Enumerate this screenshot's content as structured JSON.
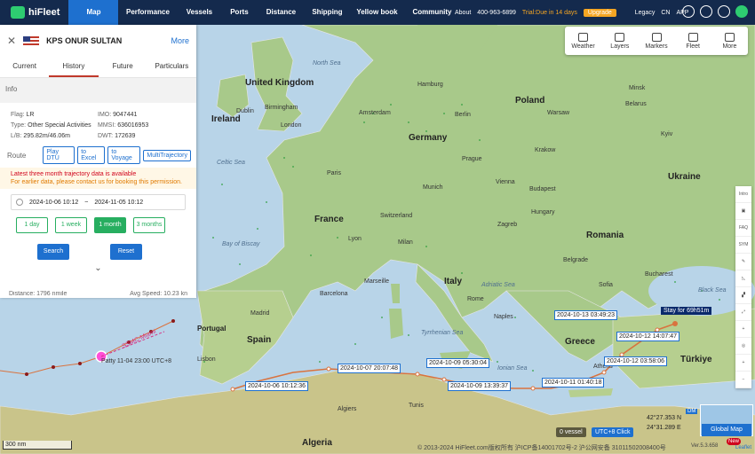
{
  "nav": {
    "brand": "hiFleet",
    "items": [
      "Map",
      "Performance",
      "Vessels",
      "Ports",
      "Distance",
      "Shipping",
      "Yellow book",
      "Community"
    ],
    "active": "Map",
    "about": "About",
    "phone": "400-963-6899",
    "trial": "Trial:Due in 14 days",
    "upgrade": "Upgrade",
    "legacy": "Legacy",
    "lang": "CN",
    "app": "APP"
  },
  "panel": {
    "ship_name": "KPS ONUR SULTAN",
    "more": "More",
    "tabs": [
      "Current",
      "History",
      "Future",
      "Particulars"
    ],
    "active_tab": "History",
    "info_title": "Info",
    "fields": [
      {
        "label": "Flag:",
        "value": "LR"
      },
      {
        "label": "IMO:",
        "value": "9047441"
      },
      {
        "label": "Type:",
        "value": "Other Special Activities"
      },
      {
        "label": "MMSI:",
        "value": "636016953"
      },
      {
        "label": "L/B:",
        "value": "295.82m/46.06m"
      },
      {
        "label": "DWT:",
        "value": "172639"
      }
    ],
    "route_label": "Route",
    "route_buttons": [
      "Play DTU",
      "to Excel",
      "to Voyage",
      "MultiTrajectory"
    ],
    "notice_line1": "Latest three month trajectory data is available",
    "notice_line2": "For earlier data, please contact us for booking this permission.",
    "date_from": "2024-10-06 10:12",
    "date_sep": "~",
    "date_to": "2024-11-05 10:12",
    "quick": [
      "1 day",
      "1 week",
      "1 month",
      "3 months"
    ],
    "quick_active": "1 month",
    "search": "Search",
    "reset": "Reset",
    "distance": "Distance: 1796 nmile",
    "avg_speed": "Avg Speed: 10.23 kn"
  },
  "tools": [
    "Weather",
    "Layers",
    "Markers",
    "Fleet",
    "More"
  ],
  "vbar": [
    "Intro",
    "",
    "FAQ",
    "SYM",
    "",
    "",
    "",
    "",
    "+",
    "",
    "+",
    "−"
  ],
  "map": {
    "countries": [
      {
        "name": "United Kingdom"
      },
      {
        "name": "Ireland"
      },
      {
        "name": "Poland"
      },
      {
        "name": "Germany"
      },
      {
        "name": "France"
      },
      {
        "name": "Ukraine"
      },
      {
        "name": "Romania"
      },
      {
        "name": "Italy"
      },
      {
        "name": "Spain"
      },
      {
        "name": "Portugal"
      },
      {
        "name": "Greece"
      },
      {
        "name": "Türkiye"
      },
      {
        "name": "Algeria"
      },
      {
        "name": "Switzerland"
      },
      {
        "name": "Hungary"
      },
      {
        "name": "Belarus"
      }
    ],
    "cities": [
      "London",
      "Paris",
      "Berlin",
      "Prague",
      "Vienna",
      "Warsaw",
      "Rome",
      "Madrid",
      "Bucharest",
      "Budapest",
      "Munich",
      "Hamburg",
      "Amsterdam",
      "Milan",
      "Barcelona",
      "Lyon",
      "Belgrade",
      "Sofia",
      "Kyiv",
      "Minsk",
      "Lisbon",
      "Athens",
      "Algiers",
      "Tunis",
      "Dublin",
      "Birmingham",
      "Marseille",
      "Naples",
      "Zagreb",
      "Krakow"
    ],
    "seas": [
      "Tyrrhenian Sea",
      "Ionian Sea",
      "Adriatic Sea",
      "Black Sea",
      "Bay of Biscay",
      "Celtic Sea",
      "North Sea"
    ]
  },
  "track": {
    "points": [
      "2024-10-06 10:12:36",
      "2024-10-07 20:07:48",
      "2024-10-09 05:30:04",
      "2024-10-09 13:39:37",
      "2024-10-11 01:40:18",
      "2024-10-12 03:58:06",
      "2024-10-12 14:07:47",
      "2024-10-13 03:49:23"
    ],
    "stay": "Stay for 69h51m",
    "storm_name": "Patty 11-04 23:00 UTC+8",
    "storm_label": "SSMC-Miami"
  },
  "bottom": {
    "scale": "300 nm",
    "vessel_count": "0 vessel",
    "utc_click": "UTC+8 Click",
    "lat": "42°27.353 N",
    "lon": "24°31.289 E",
    "dm": "DM",
    "global_map": "Global Map",
    "footer": "© 2013-2024 HiFleet.com版权所有 沪ICP备14001702号-2 沪公网安备 31011502008400号",
    "version": "Ver.5.3.658",
    "new": "New",
    "leaflet": "Leaflet"
  },
  "colors": {
    "nav_bg": "#142a4d",
    "accent": "#1e70cf",
    "track": "#d9733f",
    "storm": "#d63384",
    "quick_green": "#27ae60"
  }
}
